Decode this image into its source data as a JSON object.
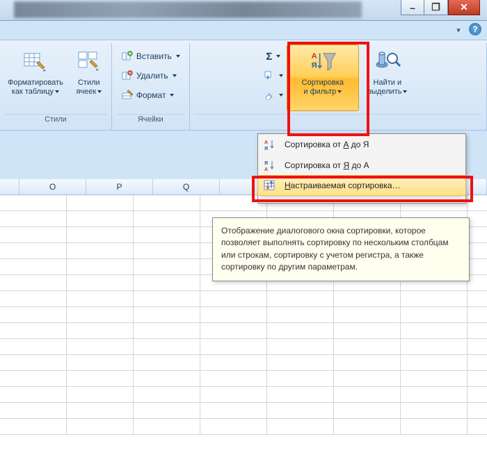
{
  "window": {
    "min_glyph": "–",
    "max_glyph": "❐",
    "close_glyph": "✕",
    "ribbon_min_glyph": "▾",
    "help_glyph": "?"
  },
  "ribbon": {
    "sum_glyph": "Σ",
    "styles": {
      "group_label": "Стили",
      "format_as_table": {
        "line1": "Форматировать",
        "line2": "как таблицу"
      },
      "cell_styles": {
        "line1": "Стили",
        "line2": "ячеек"
      }
    },
    "cells": {
      "group_label": "Ячейки",
      "insert": "Вставить",
      "delete": "Удалить",
      "format": "Формат"
    },
    "editing": {
      "sort_filter": {
        "line1": "Сортировка",
        "line2": "и фильтр"
      },
      "find_select": {
        "line1": "Найти и",
        "line2": "выделить"
      }
    }
  },
  "menu": {
    "sort_az_prefix": "Сортировка от ",
    "sort_az_u": "А",
    "sort_az_suffix": " до Я",
    "sort_za_prefix": "Сортировка от ",
    "sort_za_u": "Я",
    "sort_za_suffix": " до А",
    "custom_sort_u": "Н",
    "custom_sort_rest": "астраиваемая сортировка…"
  },
  "tooltip": {
    "text": "Отображение диалогового окна сортировки, которое позволяет выполнять сортировку по нескольким столбцам или строкам, сортировку с учетом регистра, а также сортировку по другим параметрам."
  },
  "columns": [
    "O",
    "P",
    "Q"
  ]
}
